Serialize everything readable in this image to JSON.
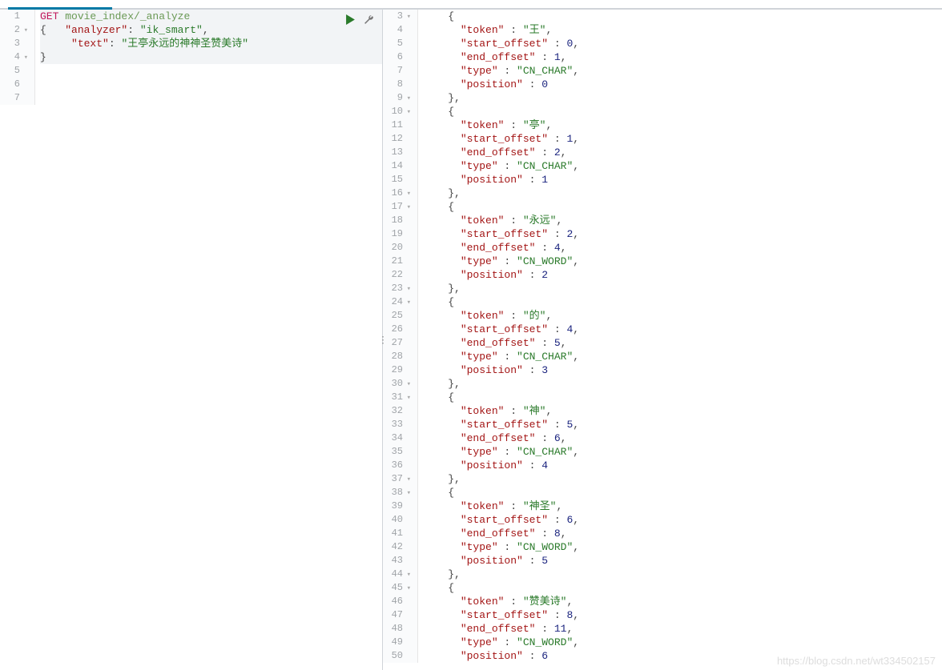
{
  "left_editor": {
    "method": "GET",
    "path": "movie_index/_analyze",
    "body_keys": {
      "analyzer": "analyzer",
      "text": "text"
    },
    "body_values": {
      "analyzer": "ik_smart",
      "text": "王亭永远的神神圣赞美诗"
    },
    "line_numbers": [
      "1",
      "2",
      "3",
      "4",
      "5",
      "6",
      "7"
    ]
  },
  "right_editor": {
    "line_numbers": [
      "3",
      "4",
      "5",
      "6",
      "7",
      "8",
      "9",
      "10",
      "11",
      "12",
      "13",
      "14",
      "15",
      "16",
      "17",
      "18",
      "19",
      "20",
      "21",
      "22",
      "23",
      "24",
      "25",
      "26",
      "27",
      "28",
      "29",
      "30",
      "31",
      "32",
      "33",
      "34",
      "35",
      "36",
      "37",
      "38",
      "39",
      "40",
      "41",
      "42",
      "43",
      "44",
      "45",
      "46",
      "47",
      "48",
      "49",
      "50"
    ],
    "keys": {
      "token": "token",
      "start_offset": "start_offset",
      "end_offset": "end_offset",
      "type": "type",
      "position": "position"
    },
    "tokens": [
      {
        "token": "王",
        "start_offset": "0",
        "end_offset": "1",
        "type": "CN_CHAR",
        "position": "0"
      },
      {
        "token": "亭",
        "start_offset": "1",
        "end_offset": "2",
        "type": "CN_CHAR",
        "position": "1"
      },
      {
        "token": "永远",
        "start_offset": "2",
        "end_offset": "4",
        "type": "CN_WORD",
        "position": "2"
      },
      {
        "token": "的",
        "start_offset": "4",
        "end_offset": "5",
        "type": "CN_CHAR",
        "position": "3"
      },
      {
        "token": "神",
        "start_offset": "5",
        "end_offset": "6",
        "type": "CN_CHAR",
        "position": "4"
      },
      {
        "token": "神圣",
        "start_offset": "6",
        "end_offset": "8",
        "type": "CN_WORD",
        "position": "5"
      },
      {
        "token": "赞美诗",
        "start_offset": "8",
        "end_offset": "11",
        "type": "CN_WORD",
        "position": "6"
      }
    ]
  },
  "watermark": "https://blog.csdn.net/wt334502157"
}
